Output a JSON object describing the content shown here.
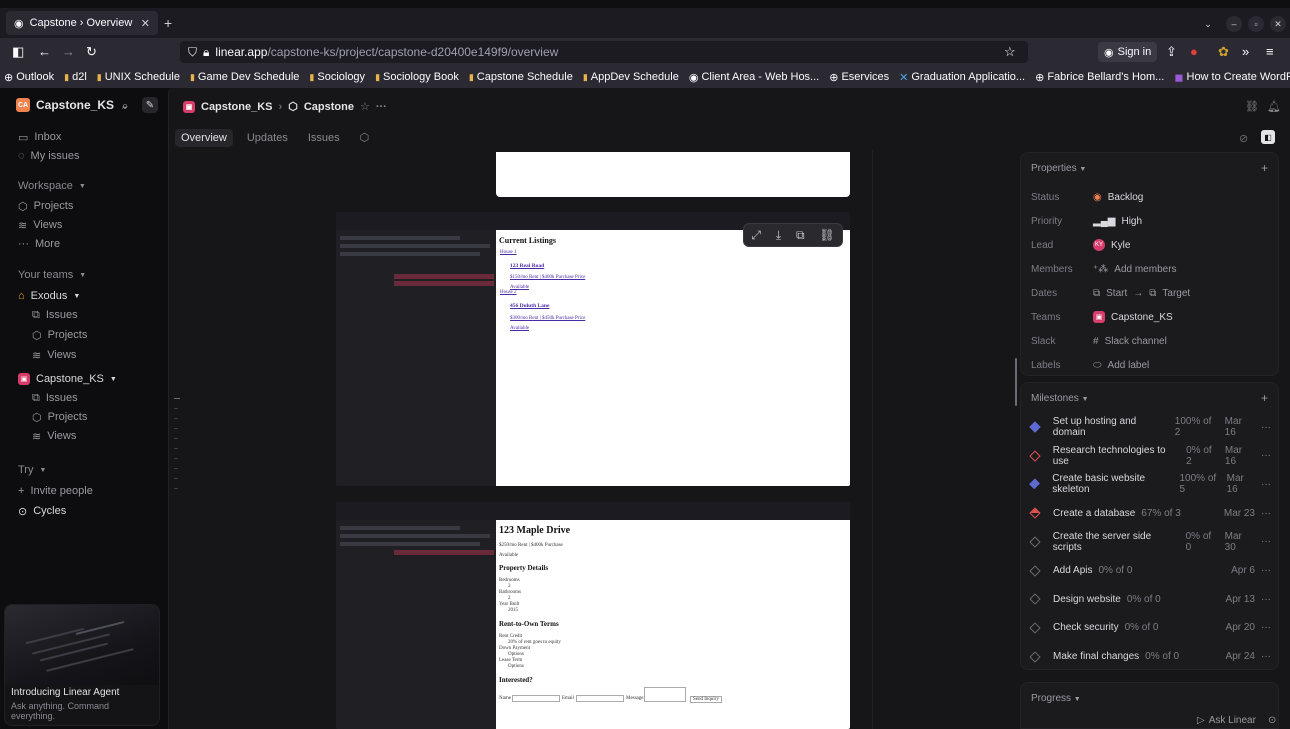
{
  "browser": {
    "tab_title": "Capstone › Overview",
    "url_host": "linear.app",
    "url_path": "/capstone-ks/project/capstone-d20400e149f9/overview",
    "signin_label": "Sign in",
    "bookmarks": [
      "Outlook",
      "d2l",
      "UNIX Schedule",
      "Game Dev Schedule",
      "Sociology",
      "Sociology Book",
      "Capstone Schedule",
      "AppDev Schedule",
      "Client Area - Web Hos...",
      "Eservices",
      "Graduation Applicatio...",
      "Fabrice Bellard's Hom...",
      "How to Create WordP..."
    ]
  },
  "sidebar": {
    "workspace": "Capstone_KS",
    "workspace_initials": "CA",
    "inbox": "Inbox",
    "my_issues": "My issues",
    "workspace_hdr": "Workspace",
    "projects": "Projects",
    "views": "Views",
    "more": "More",
    "your_teams": "Your teams",
    "team1": "Exodus",
    "team1_issues": "Issues",
    "team1_projects": "Projects",
    "team1_views": "Views",
    "team2": "Capstone_KS",
    "team2_issues": "Issues",
    "team2_projects": "Projects",
    "team2_views": "Views",
    "try": "Try",
    "invite": "Invite people",
    "cycles": "Cycles",
    "agent_title": "Introducing Linear Agent",
    "agent_desc": "Ask anything. Command everything."
  },
  "main": {
    "crumb_team": "Capstone_KS",
    "crumb_project": "Capstone",
    "tabs": [
      "Overview",
      "Updates",
      "Issues"
    ],
    "ask_linear": "Ask Linear"
  },
  "embedded": {
    "listings_title": "Current Listings",
    "house1": "House 1",
    "house1_addr": "123 Real Road",
    "house1_price": "$150/mo Rent | $400k Purchase Price",
    "house1_status": "Available",
    "house2": "House 2",
    "house2_addr": "456 Duluth Lane",
    "house2_price": "$300/mo Rent | $450k Purchase Price",
    "house2_status": "Available",
    "detail_title": "123 Maple Drive",
    "detail_price": "$250/mo Rent | $400k Purchase",
    "detail_status": "Available",
    "details_hdr": "Property Details",
    "bedrooms": "Bedrooms",
    "bedrooms_v": "3",
    "bathrooms": "Bathrooms",
    "bathrooms_v": "2",
    "year_built": "Year Built",
    "year_built_v": "2015",
    "rto_hdr": "Rent-to-Own Terms",
    "rent_credit": "Rent Credit",
    "rent_credit_v": "20% of rent goes to equity",
    "down_payment": "Down Payment",
    "down_payment_v": "Options",
    "lease_term": "Lease Term",
    "lease_term_v": "Options",
    "interested": "Interested?",
    "form_name": "Name",
    "form_email": "Email",
    "form_message": "Message",
    "form_send": "Send Inquiry"
  },
  "properties": {
    "title": "Properties",
    "rows": [
      {
        "key": "Status",
        "value": "Backlog"
      },
      {
        "key": "Priority",
        "value": "High"
      },
      {
        "key": "Lead",
        "value": "Kyle"
      },
      {
        "key": "Members",
        "value": "Add members"
      },
      {
        "key": "Dates",
        "value_start": "Start",
        "value_target": "Target"
      },
      {
        "key": "Teams",
        "value": "Capstone_KS"
      },
      {
        "key": "Slack",
        "value": "Slack channel"
      },
      {
        "key": "Labels",
        "value": "Add label"
      }
    ],
    "lead_initials": "KY"
  },
  "milestones": {
    "title": "Milestones",
    "items": [
      {
        "name": "Set up hosting and domain",
        "pct": "100% of 2",
        "date": "Mar 16"
      },
      {
        "name": "Research technologies to use",
        "pct": "0% of 2",
        "date": "Mar 16"
      },
      {
        "name": "Create basic website skeleton",
        "pct": "100% of 5",
        "date": "Mar 16"
      },
      {
        "name": "Create a database",
        "pct": "67% of 3",
        "date": "Mar 23"
      },
      {
        "name": "Create the server side scripts",
        "pct": "0% of 0",
        "date": "Mar 30"
      },
      {
        "name": "Add Apis",
        "pct": "0% of 0",
        "date": "Apr 6"
      },
      {
        "name": "Design website",
        "pct": "0% of 0",
        "date": "Apr 13"
      },
      {
        "name": "Check security",
        "pct": "0% of 0",
        "date": "Apr 20"
      },
      {
        "name": "Make final changes",
        "pct": "0% of 0",
        "date": "Apr 24"
      }
    ]
  },
  "progress": {
    "title": "Progress"
  },
  "colors": {
    "accent": "#5e6ad2",
    "team": "#d63d6b",
    "status_orange": "#f0834d"
  }
}
